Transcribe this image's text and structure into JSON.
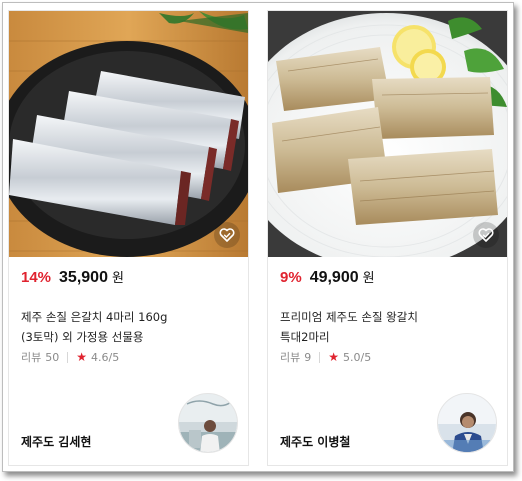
{
  "products": [
    {
      "discount": "14%",
      "price": "35,900",
      "currency": "원",
      "title_lines": [
        "제주 손질 은갈치 4마리 160g",
        "(3토막) 외 가정용 선물용"
      ],
      "review_label": "리뷰",
      "review_count": "50",
      "rating": "4.6/5",
      "seller": "제주도 김세현",
      "photo": "silver-hairtail-fish-on-dark-plate",
      "avatar": "seller-photo",
      "wishlist_icon": "heart-check-icon"
    },
    {
      "discount": "9%",
      "price": "49,900",
      "currency": "원",
      "title_lines": [
        "프리미엄 제주도 손질 왕갈치",
        "특대2마리"
      ],
      "review_label": "리뷰",
      "review_count": "9",
      "rating": "5.0/5",
      "seller": "제주도 이병철",
      "photo": "grilled-hairtail-fish-with-lemon",
      "avatar": "seller-photo",
      "wishlist_icon": "heart-check-icon"
    }
  ],
  "colors": {
    "discount": "#e0232f",
    "star": "#e0232f",
    "text": "#222222",
    "muted": "#8a8a8a"
  }
}
